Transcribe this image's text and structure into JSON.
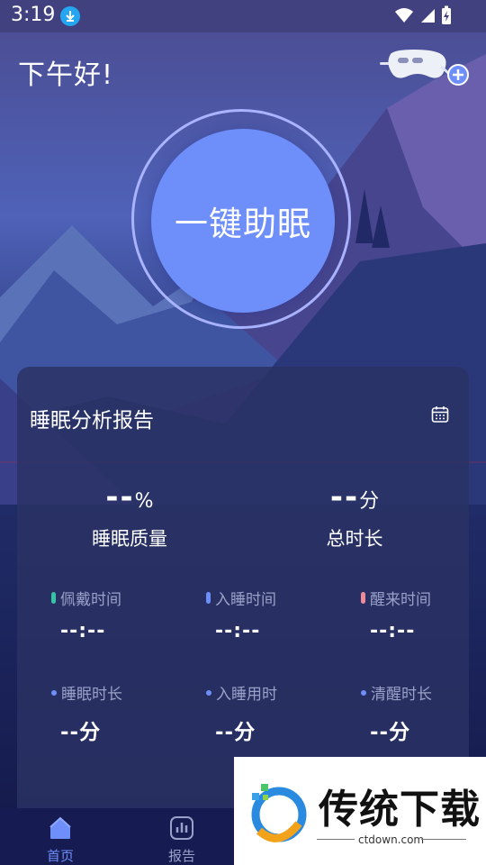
{
  "status_bar": {
    "time": "3:19"
  },
  "header": {
    "greeting": "下午好!"
  },
  "main_button": {
    "label": "一键助眠"
  },
  "report": {
    "title": "睡眠分析报告",
    "quality": {
      "value": "--",
      "unit": "%",
      "label": "睡眠质量"
    },
    "total": {
      "value": "--",
      "unit": "分",
      "label": "总时长"
    },
    "times": [
      {
        "label": "佩戴时间",
        "value": "--:--",
        "color": "#36c2a4"
      },
      {
        "label": "入睡时间",
        "value": "--:--",
        "color": "#6e8efa"
      },
      {
        "label": "醒来时间",
        "value": "--:--",
        "color": "#f08a9a"
      }
    ],
    "durations": [
      {
        "label": "睡眠时长",
        "value": "--分"
      },
      {
        "label": "入睡用时",
        "value": "--分"
      },
      {
        "label": "清醒时长",
        "value": "--分"
      }
    ]
  },
  "nav": {
    "items": [
      {
        "label": "首页",
        "active": true
      },
      {
        "label": "报告",
        "active": false
      }
    ]
  },
  "watermark": {
    "brand": "传统下载",
    "url": "ctdown.com"
  },
  "colors": {
    "accent": "#6e8efa",
    "ring": "#a9b3ff",
    "nav_active": "#6e8efa",
    "nav_inactive": "#9aa1c8"
  }
}
